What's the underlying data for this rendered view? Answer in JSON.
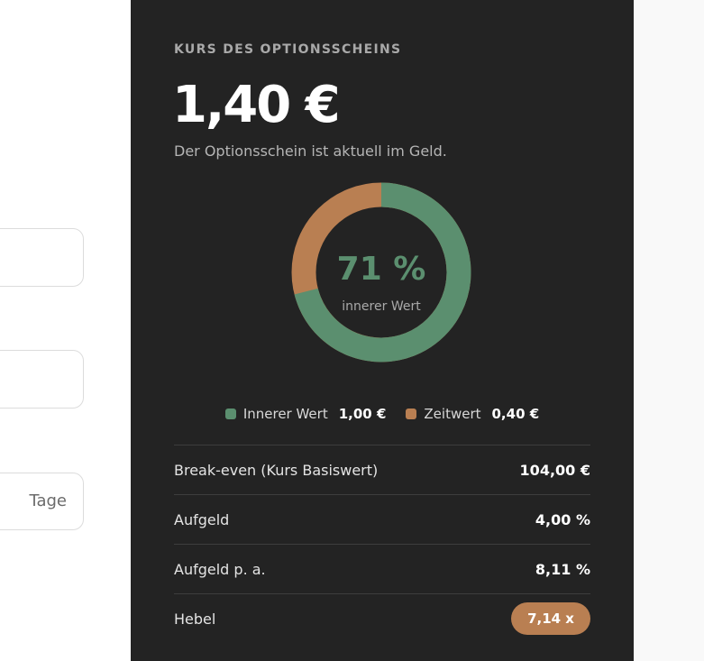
{
  "form": {
    "fields": [
      {
        "value": "",
        "suffix": ""
      },
      {
        "value": "",
        "suffix": ""
      },
      {
        "value": "",
        "suffix": "Tage"
      }
    ]
  },
  "panel": {
    "eyebrow": "KURS DES OPTIONSSCHEINS",
    "price": "1,40 €",
    "subtitle": "Der Optionsschein ist aktuell im Geld.",
    "donut": {
      "percent_label": "71 %",
      "center_caption": "innerer Wert",
      "inner_fraction": 0.71,
      "colors": {
        "inner": "#5b8f6f",
        "time": "#b97f52"
      }
    },
    "legend": [
      {
        "label": "Innerer Wert",
        "value": "1,00 €",
        "color": "#5b8f6f"
      },
      {
        "label": "Zeitwert",
        "value": "0,40 €",
        "color": "#b97f52"
      }
    ],
    "rows": [
      {
        "label": "Break-even (Kurs Basiswert)",
        "value": "104,00 €"
      },
      {
        "label": "Aufgeld",
        "value": "4,00 %"
      },
      {
        "label": "Aufgeld p. a.",
        "value": "8,11 %"
      },
      {
        "label": "Hebel",
        "value": "7,14 x"
      }
    ]
  }
}
